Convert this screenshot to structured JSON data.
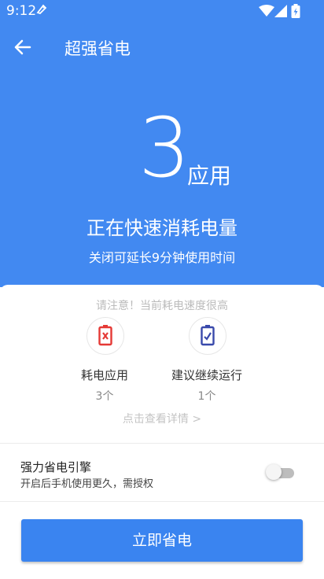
{
  "status_bar": {
    "time": "9:12"
  },
  "header": {
    "title": "超强省电"
  },
  "hero": {
    "app_count": "3",
    "app_unit": "应用",
    "headline": "正在快速消耗电量",
    "subline": "关闭可延长9分钟使用时间"
  },
  "summary": {
    "notice": "请注意！当前耗电速度很高",
    "items": [
      {
        "label": "耗电应用",
        "count": "3个",
        "icon": "battery-alert-icon",
        "color": "#e53935"
      },
      {
        "label": "建议继续运行",
        "count": "1个",
        "icon": "battery-ok-icon",
        "color": "#3949ab"
      }
    ],
    "detail_link": "点击查看详情 >"
  },
  "engine": {
    "title": "强力省电引擎",
    "description": "开启后手机使用更久，需授权",
    "enabled": false
  },
  "action": {
    "label": "立即省电"
  },
  "colors": {
    "primary": "#4289f1",
    "button": "#3a84f0"
  }
}
